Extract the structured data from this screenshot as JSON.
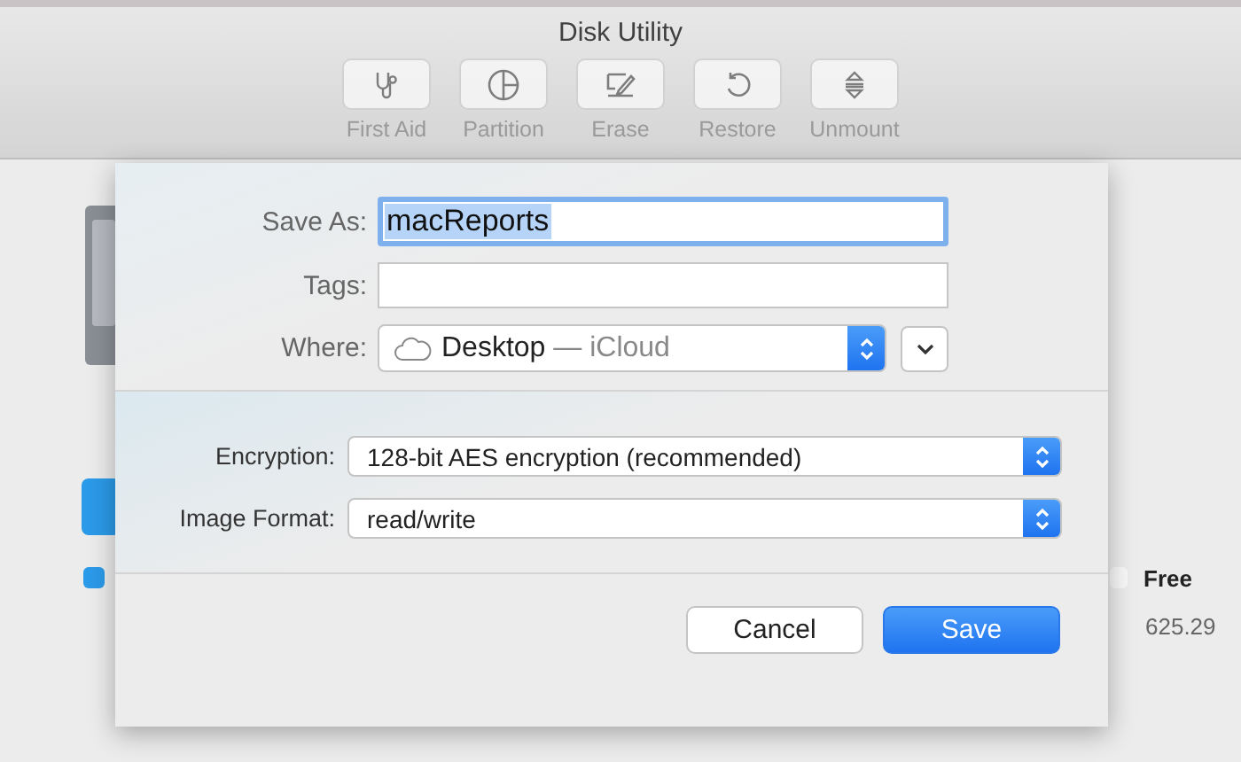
{
  "window": {
    "title": "Disk Utility"
  },
  "toolbar": [
    {
      "label": "First Aid",
      "kind": "stethoscope",
      "disabled": true
    },
    {
      "label": "Partition",
      "kind": "pie",
      "disabled": true
    },
    {
      "label": "Erase",
      "kind": "erase",
      "disabled": true
    },
    {
      "label": "Restore",
      "kind": "restore",
      "disabled": true
    },
    {
      "label": "Unmount",
      "kind": "unmount",
      "disabled": true
    }
  ],
  "background": {
    "legend_label": "Free",
    "legend_value": "625.29"
  },
  "dialog": {
    "save_as": {
      "label": "Save As:",
      "value": "macReports"
    },
    "tags": {
      "label": "Tags:"
    },
    "where": {
      "label": "Where:",
      "value": "Desktop",
      "location": "— iCloud"
    },
    "options": [
      {
        "label": "Encryption:",
        "value": "128-bit AES encryption (recommended)"
      },
      {
        "label": "Image Format:",
        "value": "read/write"
      }
    ],
    "buttons": [
      {
        "label": "Cancel",
        "default": false
      },
      {
        "label": "Save",
        "default": true
      }
    ]
  }
}
